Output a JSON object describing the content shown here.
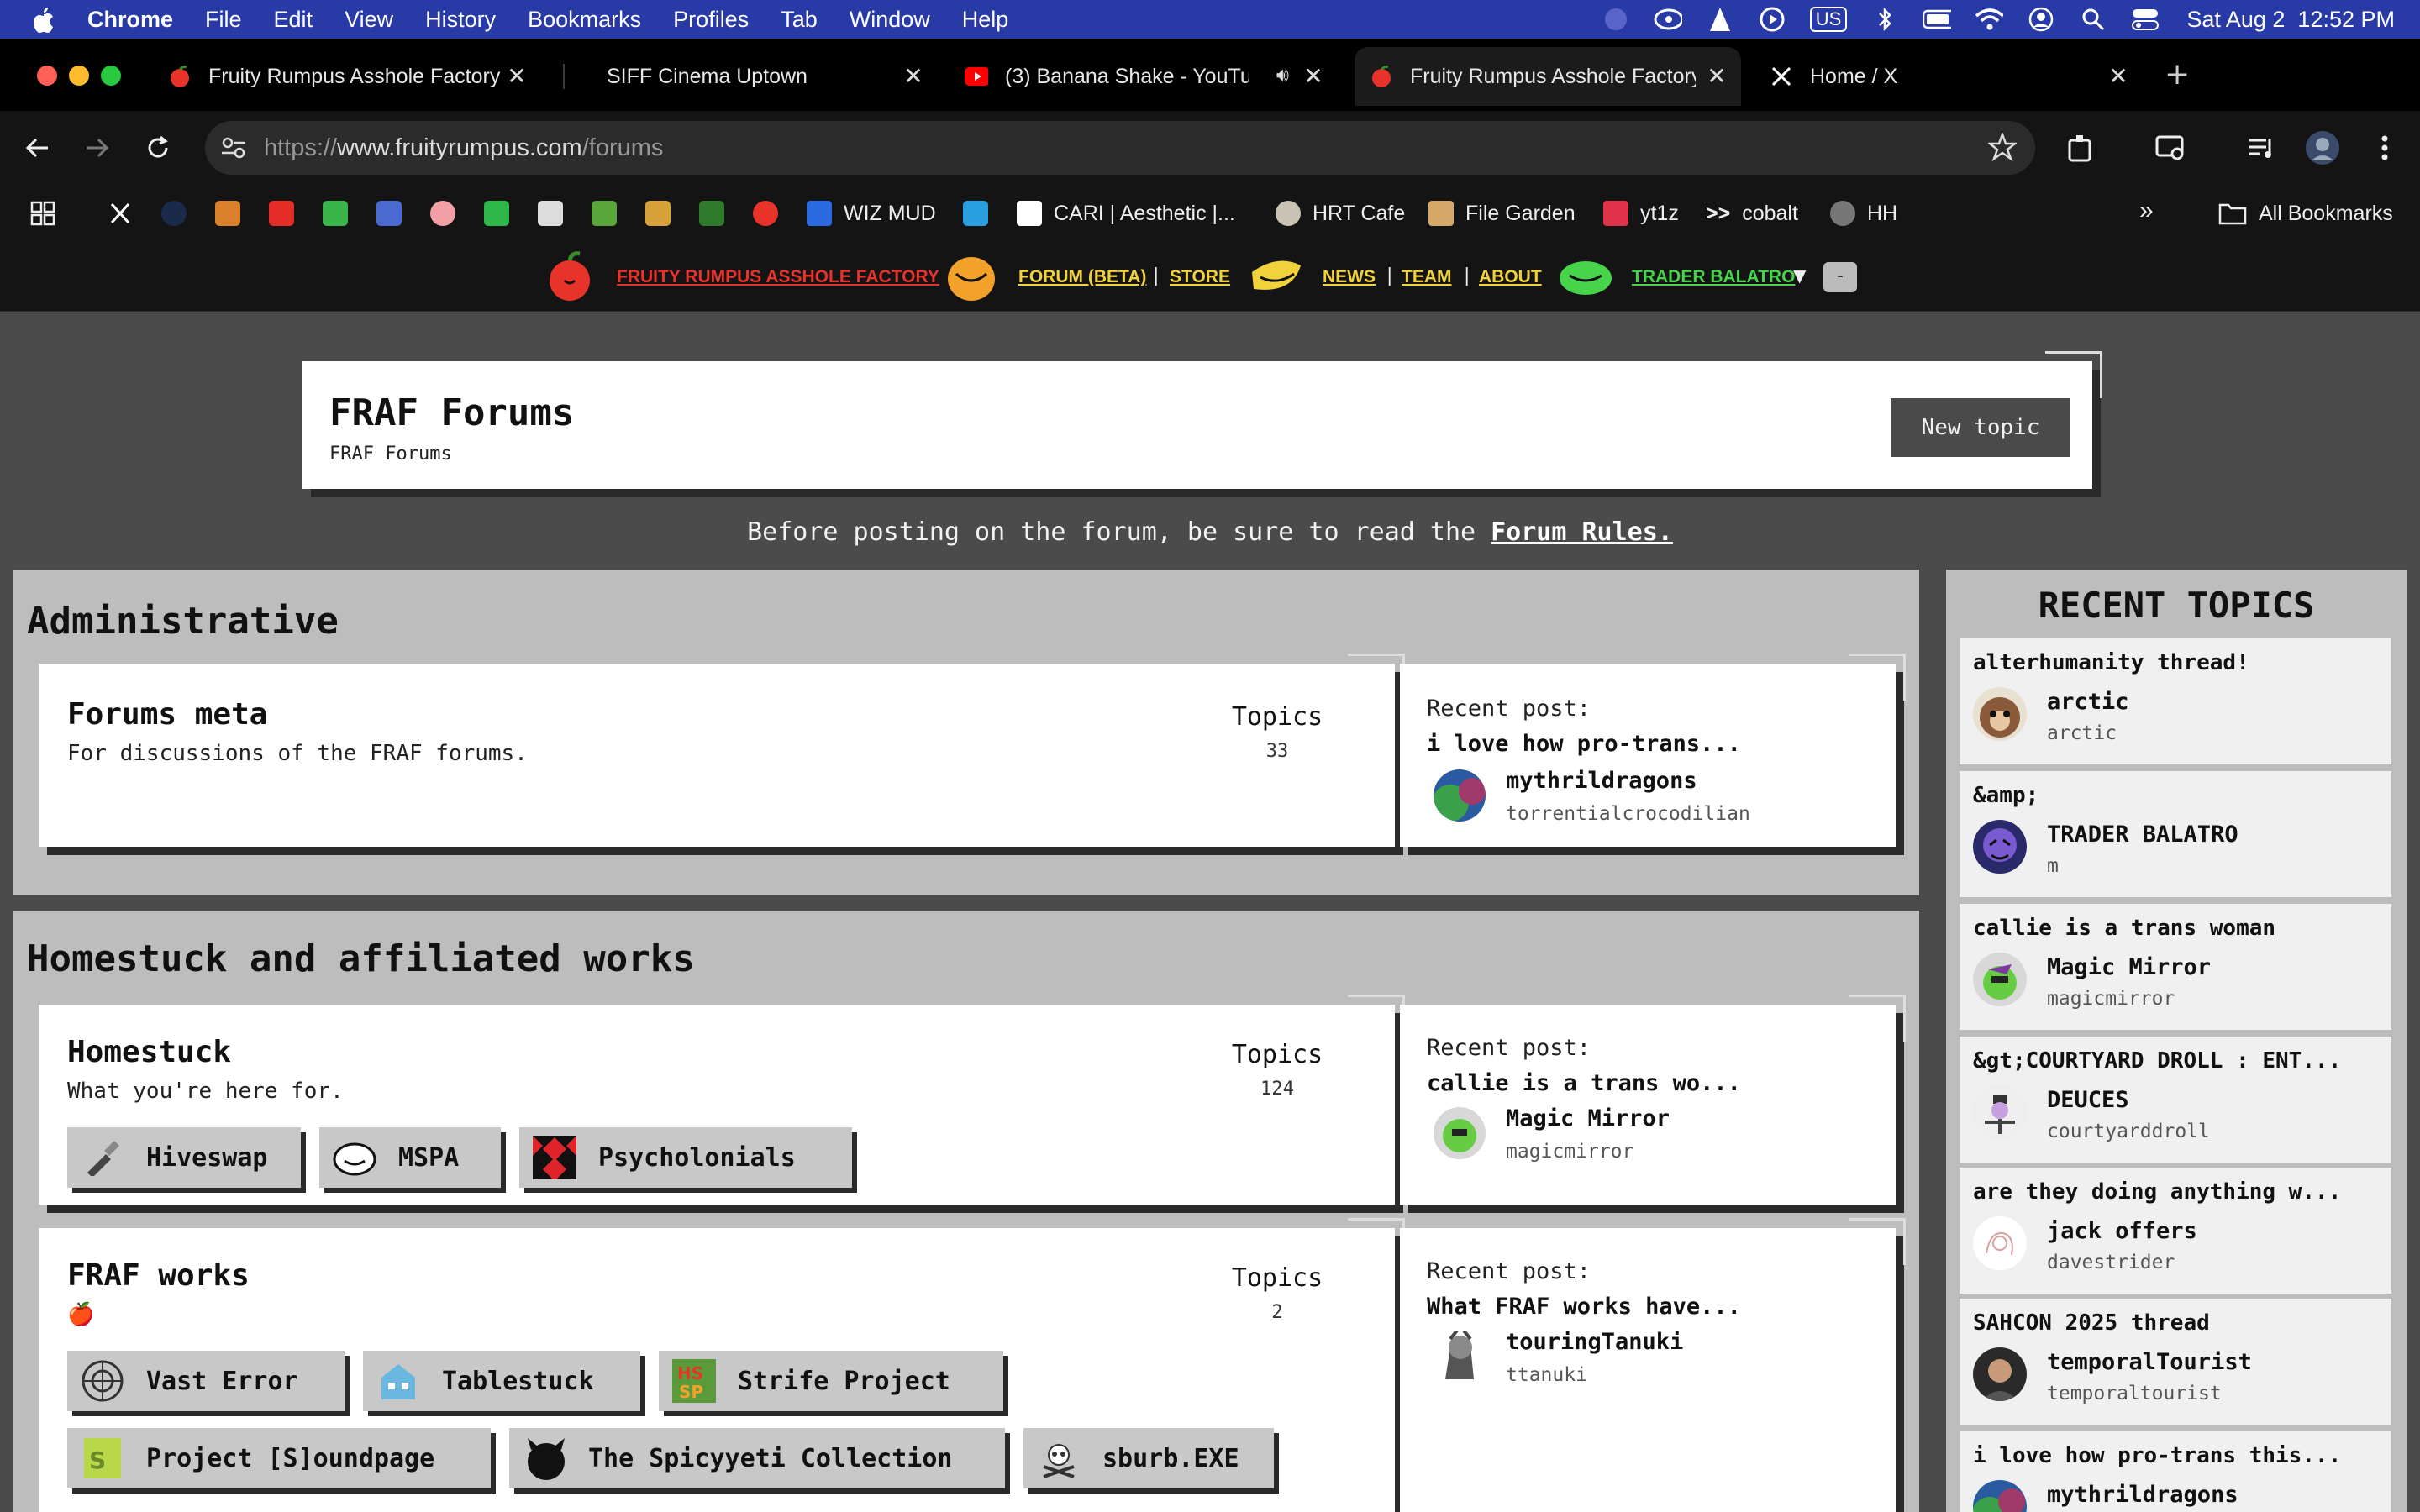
{
  "menubar": {
    "app": "Chrome",
    "items": [
      "File",
      "Edit",
      "View",
      "History",
      "Bookmarks",
      "Profiles",
      "Tab",
      "Window",
      "Help"
    ],
    "input_source": "US",
    "clock": "Sat Aug 2  12:52 PM"
  },
  "tabs": [
    {
      "title": "Fruity Rumpus Asshole Factory",
      "icon": "apple-icon"
    },
    {
      "title": "SIFF Cinema Uptown",
      "icon": "none"
    },
    {
      "title": "(3) Banana Shake - YouTube",
      "icon": "youtube-icon"
    },
    {
      "title": "Fruity Rumpus Asshole Factory",
      "icon": "apple-icon"
    },
    {
      "title": "Home / X",
      "icon": "x-icon"
    }
  ],
  "address": {
    "scheme": "https://",
    "host": "www.fruityrumpus.com",
    "path": "/forums"
  },
  "bookmarks": {
    "wiz_mud": "WIZ MUD",
    "cari": "CARI | Aesthetic |...",
    "hrt": "HRT Cafe",
    "filegarden": "File Garden",
    "yt1z": "yt1z",
    "cobalt": "cobalt",
    "hh": "HH",
    "all": "All Bookmarks"
  },
  "sitenav": {
    "home": "FRUITY RUMPUS ASSHOLE FACTORY",
    "forum": "FORUM (BETA)",
    "store": "STORE",
    "news": "NEWS",
    "team": "TEAM",
    "about": "ABOUT",
    "trader": "TRADER BALATRO",
    "caret": "▼",
    "minus": "-",
    "sep": "|",
    "colors": {
      "red": "#e8332b",
      "yellow": "#f2d23a",
      "green": "#47d44a"
    }
  },
  "header": {
    "title": "FRAF Forums",
    "breadcrumb": "FRAF Forums",
    "new_topic": "New topic"
  },
  "notice": {
    "text": "Before posting on the forum, be sure to read the ",
    "link": "Forum Rules."
  },
  "sections": [
    {
      "title": "Administrative",
      "forums": [
        {
          "name": "Forums meta",
          "desc": "For discussions of the FRAF forums.",
          "topics_label": "Topics",
          "topics": "33",
          "recent": {
            "label": "Recent post:",
            "title": "i love how pro-trans...",
            "user": "mythrildragons",
            "handle": "torrentialcrocodilian"
          }
        }
      ]
    },
    {
      "title": "Homestuck and affiliated works",
      "forums": [
        {
          "name": "Homestuck",
          "desc": "What you're here for.",
          "topics_label": "Topics",
          "topics": "124",
          "subforums": [
            "Hiveswap",
            "MSPA",
            "Psycholonials"
          ],
          "recent": {
            "label": "Recent post:",
            "title": "callie is a trans wo...",
            "user": "Magic Mirror",
            "handle": "magicmirror"
          }
        },
        {
          "name": "FRAF works",
          "desc": "🍎",
          "topics_label": "Topics",
          "topics": "2",
          "subforums": [
            "Vast Error",
            "Tablestuck",
            "Strife Project",
            "Project [S]oundpage",
            "The Spicyyeti Collection",
            "sburb.EXE"
          ],
          "recent": {
            "label": "Recent post:",
            "title": "What FRAF works have...",
            "user": "touringTanuki",
            "handle": "ttanuki"
          }
        }
      ]
    }
  ],
  "recent_topics": {
    "heading": "RECENT TOPICS",
    "items": [
      {
        "title": "alterhumanity thread!",
        "user": "arctic",
        "handle": "arctic"
      },
      {
        "title": "&amp;",
        "user": "TRADER BALATRO",
        "handle": "m"
      },
      {
        "title": "callie is a trans woman",
        "user": "Magic Mirror",
        "handle": "magicmirror"
      },
      {
        "title": "&gt;COURTYARD DROLL : ENT...",
        "user": "DEUCES",
        "handle": "courtyarddroll"
      },
      {
        "title": "are they doing anything w...",
        "user": "jack offers",
        "handle": "davestrider"
      },
      {
        "title": "SAHCON 2025 thread",
        "user": "temporalTourist",
        "handle": "temporaltourist"
      },
      {
        "title": "i love how pro-trans this...",
        "user": "mythrildragons",
        "handle": ""
      }
    ]
  }
}
